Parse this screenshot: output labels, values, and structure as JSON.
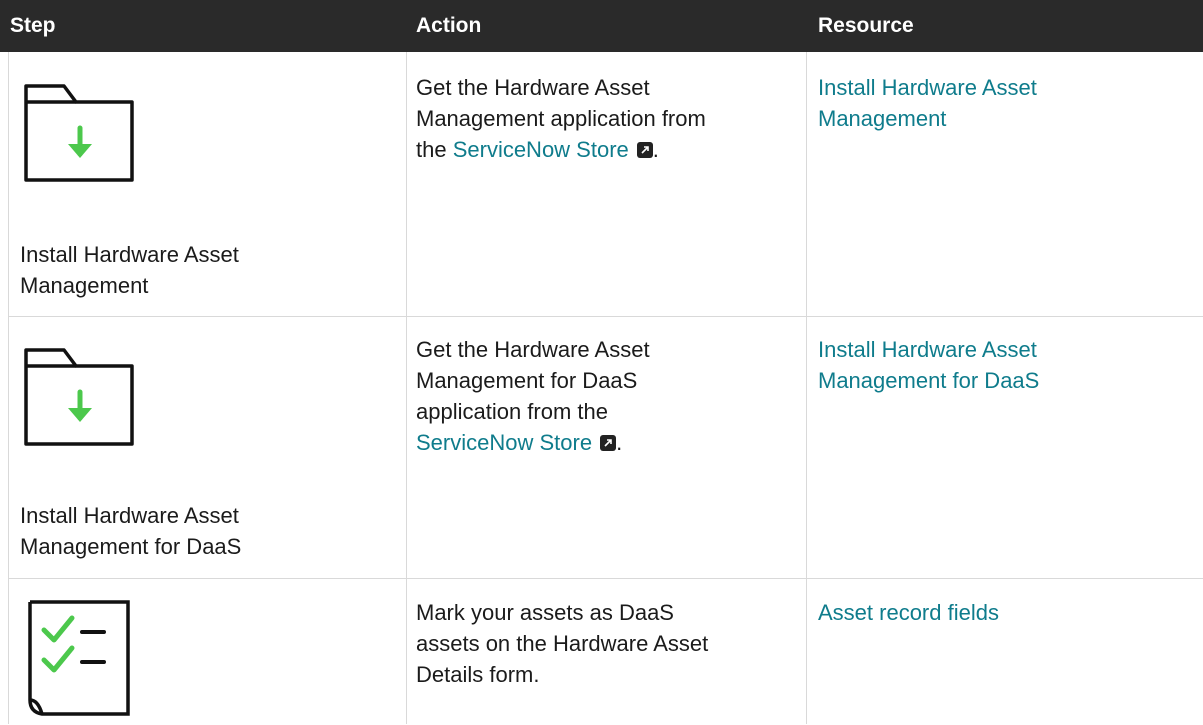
{
  "headers": {
    "step": "Step",
    "action": "Action",
    "resource": "Resource"
  },
  "rows": [
    {
      "step_icon": "folder-download-icon",
      "step_label_line1": "Install Hardware Asset",
      "step_label_line2": "Management",
      "action_line1": "Get the Hardware Asset",
      "action_line2": "Management application from",
      "action_prefix": "the ",
      "action_link": "ServiceNow Store",
      "action_suffix": ".",
      "resource_line1": "Install Hardware Asset",
      "resource_line2": "Management"
    },
    {
      "step_icon": "folder-download-icon",
      "step_label_line1": "Install Hardware Asset",
      "step_label_line2": "Management for DaaS",
      "action_line1": "Get the Hardware Asset",
      "action_line2": "Management for DaaS",
      "action_line3": "application from the",
      "action_link": "ServiceNow Store",
      "action_suffix": ".",
      "resource_line1": "Install Hardware Asset",
      "resource_line2": "Management for DaaS"
    },
    {
      "step_icon": "checklist-icon",
      "action_line1": "Mark your assets as DaaS",
      "action_line2": "assets on the Hardware Asset",
      "action_line3": "Details form.",
      "resource_line1": "Asset record fields"
    }
  ],
  "colors": {
    "header_bg": "#2a2a2a",
    "link": "#0f7c8c",
    "icon_accent": "#4cc84c"
  },
  "external_link_icon": "external-link-icon"
}
